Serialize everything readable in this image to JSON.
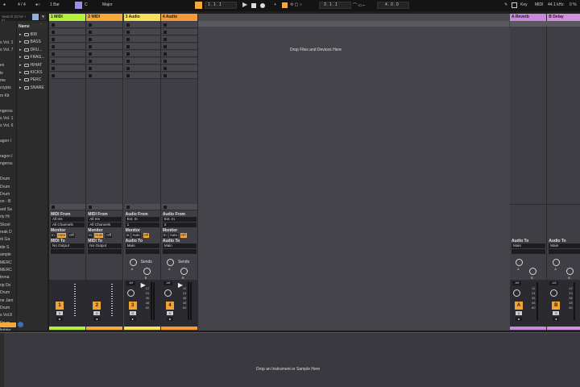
{
  "colors": {
    "midi1": "#b7f03b",
    "midi2": "#f4a93a",
    "audio3": "#f6e25a",
    "audio4": "#f49a3a",
    "reverb": "#c889dd",
    "delay": "#d48fe0",
    "accent": "#f4a93a"
  },
  "topbar": {
    "time_sig": "4 / 4",
    "quantize": "1 Bar",
    "key": "C",
    "scale": "Major",
    "position": "1 .  1 .  1",
    "loop_start": "3 .  1 .  1",
    "loop_length": "4 .  0 .  0",
    "key_label": "Key",
    "midi_label": "MIDI",
    "sample_rate": "44.1 kHz",
    "cpu": "0 %"
  },
  "browser": {
    "search_placeholder": "Search (Cmd + F)",
    "name_header": "Name",
    "left_items": [
      "s Vol. 1",
      "s Vol. 7",
      "",
      "es",
      "le",
      "me",
      "crypto",
      "m Kit",
      "",
      "ngerou",
      "s Vol. 1",
      "s Vol. 6",
      "",
      "agon I",
      "",
      "ragon I",
      "ngerou",
      "",
      "Drum",
      "Drum",
      "Drum",
      "on - B",
      "ard Sa",
      "rty Hi",
      "Skool",
      "reak D",
      "rk Ga",
      "ide S",
      "ample",
      "MERC",
      "MERC",
      "trona",
      "rip Do",
      "Drum",
      "ne Jam",
      "Drum",
      "s Vol.8",
      "Drum",
      "lighter"
    ],
    "folders": [
      "808",
      "BASS",
      "DRU...",
      "FRAG...",
      "HIHAT",
      "KICKS",
      "PERC",
      "SNARE"
    ]
  },
  "tracks": [
    {
      "name": "1 MIDI",
      "type": "midi",
      "from_label": "MIDI From",
      "from": "All Ins",
      "channel": "All Channels",
      "to_label": "MIDI To",
      "to": "No Output",
      "number": "1"
    },
    {
      "name": "2 MIDI",
      "type": "midi",
      "from_label": "MIDI From",
      "from": "All Ins",
      "channel": "All Channels",
      "to_label": "MIDI To",
      "to": "No Output",
      "number": "2"
    },
    {
      "name": "3 Audio",
      "type": "audio",
      "from_label": "Audio From",
      "from": "Ext. In",
      "channel": "1",
      "to_label": "Audio To",
      "to": "Main",
      "number": "3",
      "volume": "-inf"
    },
    {
      "name": "4 Audio",
      "type": "audio",
      "from_label": "Audio From",
      "from": "Ext. In",
      "channel": "2",
      "to_label": "Audio To",
      "to": "Main",
      "number": "4",
      "volume": "-inf"
    }
  ],
  "returns": [
    {
      "name": "A Reverb",
      "to_label": "Audio To",
      "to": "Main",
      "letter": "A",
      "volume": "-inf"
    },
    {
      "name": "B Delay",
      "to_label": "Audio To",
      "to": "Main",
      "letter": "B",
      "volume": "-inf"
    }
  ],
  "monitor": {
    "label": "Monitor",
    "in": "In",
    "auto": "Auto",
    "off": "Off"
  },
  "sends_label": "Sends",
  "send_a": "A",
  "send_b": "B",
  "solo_label": "S",
  "db_scale": [
    "-inf",
    "12",
    "24",
    "36",
    "48",
    "60"
  ],
  "drop_devices": "Drop Files and Devices Here",
  "drop_instrument": "Drop an Instrument or Sample Here"
}
